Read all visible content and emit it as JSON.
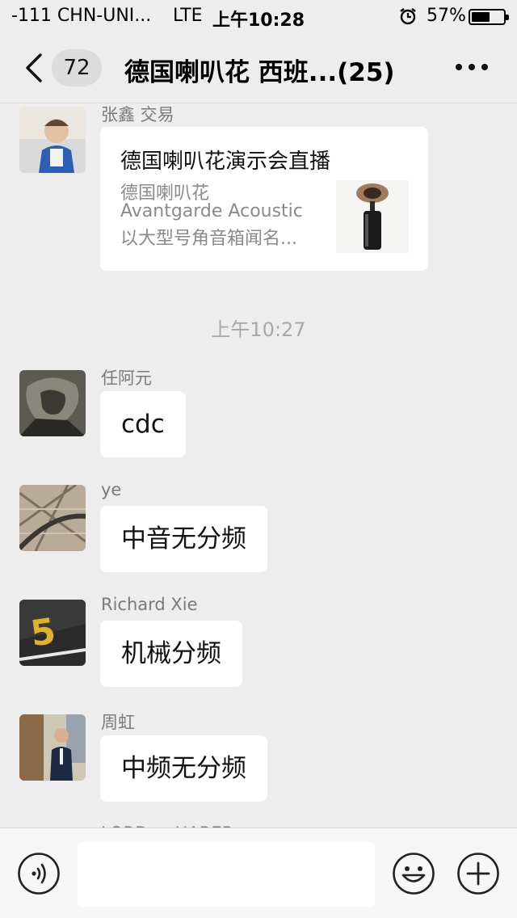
{
  "status_bar": {
    "carrier": "-111 CHN-UNI...",
    "network": "LTE",
    "time": "上午10:28",
    "battery_percent": "57%",
    "battery_level": 0.57,
    "alarm_icon": "alarm-clock-icon"
  },
  "nav": {
    "back_icon": "chevron-left-icon",
    "unread_count": "72",
    "title": "德国喇叭花 西班...(25)",
    "more_icon": "more-dots-icon"
  },
  "messages": [
    {
      "sender": "张鑫 交易",
      "type": "link",
      "card_title": "德国喇叭花演示会直播",
      "card_desc": [
        "德国喇叭花",
        "Avantgarde Acoustic",
        "以大型号角音箱闻名..."
      ]
    },
    {
      "type": "time",
      "text": "上午10:27"
    },
    {
      "sender": "任阿元",
      "type": "text",
      "text": "cdc"
    },
    {
      "sender": "ye",
      "type": "text",
      "text": "中音无分频"
    },
    {
      "sender": "Richard Xie",
      "type": "text",
      "text": "机械分频"
    },
    {
      "sender": "周虹",
      "type": "text",
      "text": "中频无分频"
    },
    {
      "sender": "LORD ... HARER",
      "type": "partial"
    }
  ],
  "input_bar": {
    "voice_icon": "voice-icon",
    "message_value": "",
    "emoji_icon": "emoji-icon",
    "plus_icon": "plus-icon"
  },
  "colors": {
    "background": "#ededed",
    "bubble": "#ffffff",
    "timestamp": "#a8a8a8",
    "sender_name": "#7a7a7a"
  }
}
